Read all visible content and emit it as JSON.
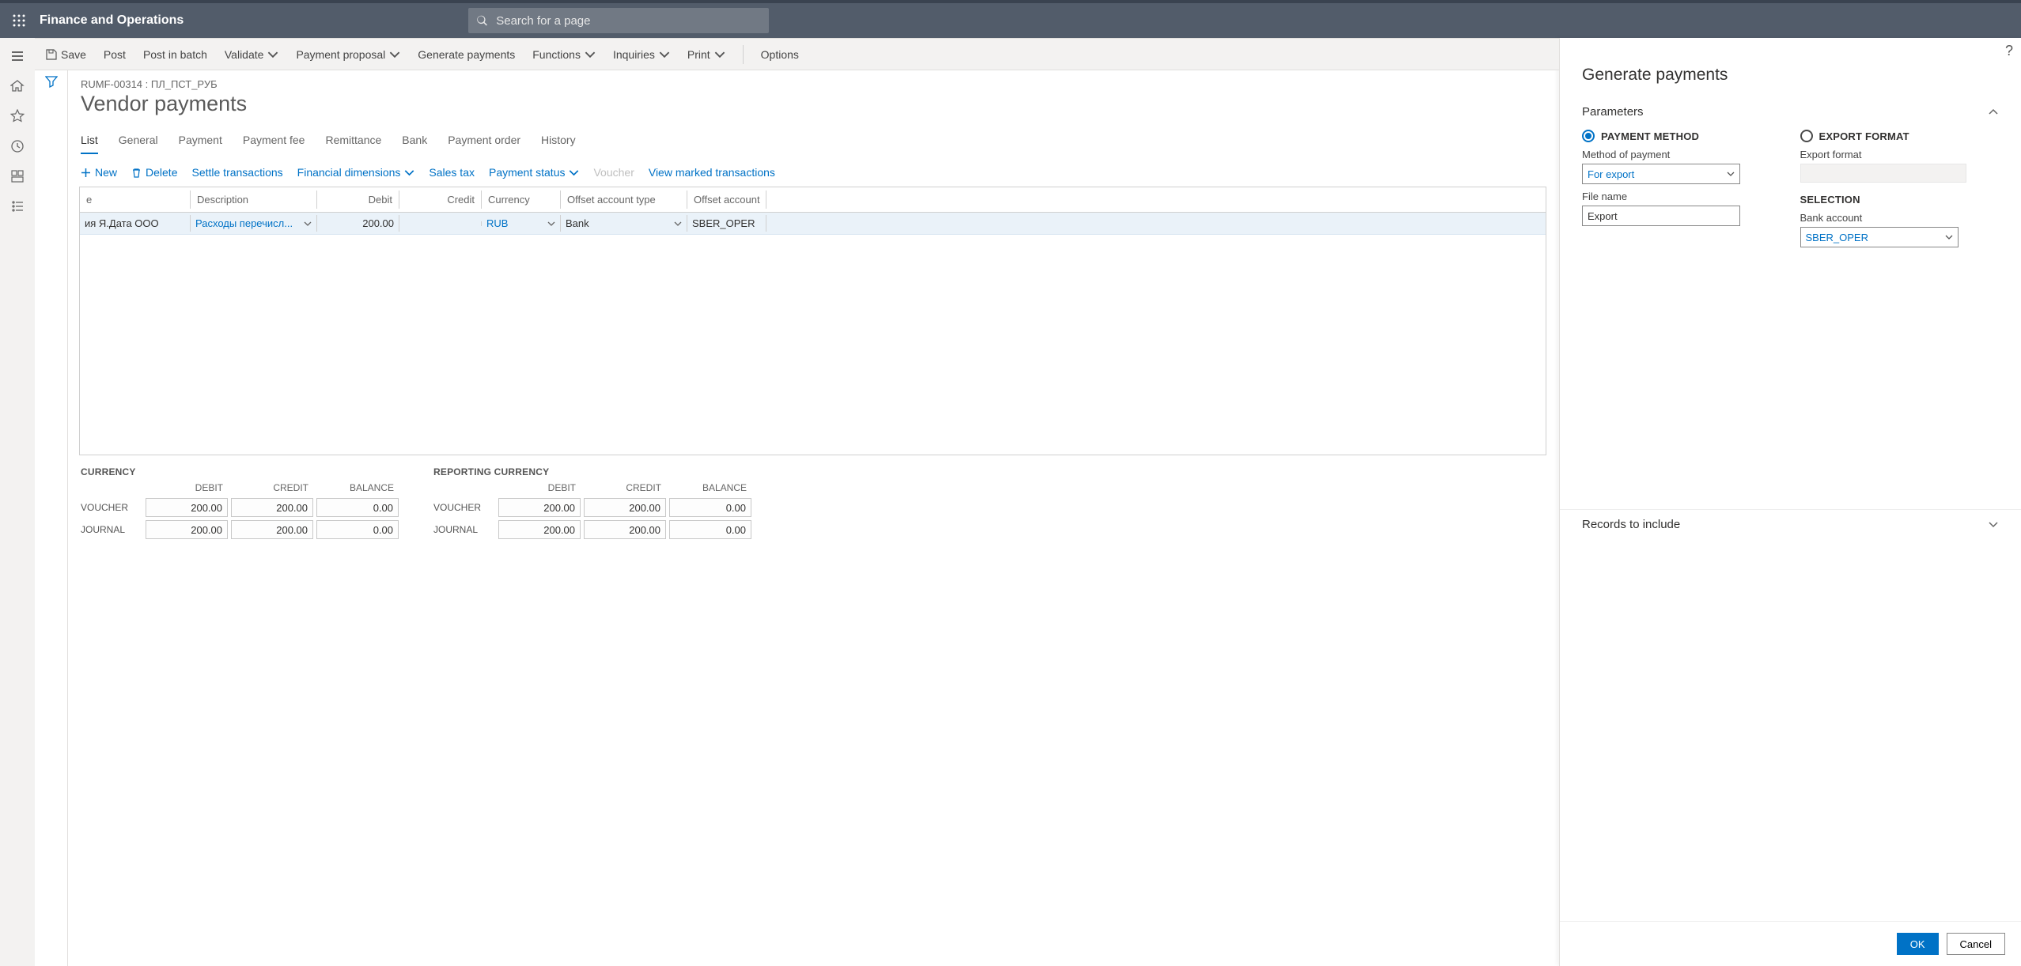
{
  "app": {
    "title": "Finance and Operations",
    "search_placeholder": "Search for a page"
  },
  "actions": {
    "save": "Save",
    "post": "Post",
    "post_batch": "Post in batch",
    "validate": "Validate",
    "payment_proposal": "Payment proposal",
    "generate_payments": "Generate payments",
    "functions": "Functions",
    "inquiries": "Inquiries",
    "print": "Print",
    "options": "Options"
  },
  "breadcrumb": "RUMF-00314 : ПЛ_ПСТ_РУБ",
  "page_title": "Vendor payments",
  "tabs": [
    "List",
    "General",
    "Payment",
    "Payment fee",
    "Remittance",
    "Bank",
    "Payment order",
    "History"
  ],
  "sub": {
    "new": "New",
    "delete": "Delete",
    "settle": "Settle transactions",
    "fin_dims": "Financial dimensions",
    "sales_tax": "Sales tax",
    "payment_status": "Payment status",
    "voucher": "Voucher",
    "view_marked": "View marked transactions"
  },
  "grid": {
    "headers": {
      "name": "e",
      "description": "Description",
      "debit": "Debit",
      "credit": "Credit",
      "currency": "Currency",
      "offset_type": "Offset account type",
      "offset_account": "Offset account"
    },
    "row": {
      "name": "ия Я.Дата ООО",
      "description": "Расходы перечисл...",
      "debit": "200.00",
      "credit": "",
      "currency": "RUB",
      "offset_type": "Bank",
      "offset_account": "SBER_OPER"
    }
  },
  "totals": {
    "currency_label": "CURRENCY",
    "reporting_label": "REPORTING CURRENCY",
    "headers": {
      "debit": "DEBIT",
      "credit": "CREDIT",
      "balance": "BALANCE"
    },
    "rows": {
      "voucher": "VOUCHER",
      "journal": "JOURNAL"
    },
    "currency": {
      "voucher": [
        "200.00",
        "200.00",
        "0.00"
      ],
      "journal": [
        "200.00",
        "200.00",
        "0.00"
      ]
    },
    "reporting": {
      "voucher": [
        "200.00",
        "200.00",
        "0.00"
      ],
      "journal": [
        "200.00",
        "200.00",
        "0.00"
      ]
    }
  },
  "panel": {
    "title": "Generate payments",
    "parameters": "Parameters",
    "records_include": "Records to include",
    "payment_method_label": "PAYMENT METHOD",
    "export_format_label": "EXPORT FORMAT",
    "method_of_payment_label": "Method of payment",
    "method_of_payment_value": "For export",
    "export_format_field_label": "Export format",
    "file_name_label": "File name",
    "file_name_value": "Export",
    "selection_label": "SELECTION",
    "bank_account_label": "Bank account",
    "bank_account_value": "SBER_OPER",
    "ok": "OK",
    "cancel": "Cancel"
  }
}
